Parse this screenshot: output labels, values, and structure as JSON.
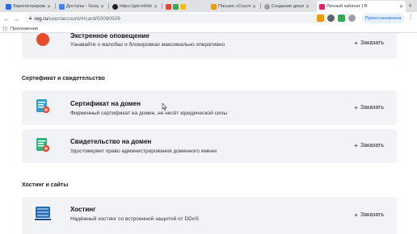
{
  "browser": {
    "tabs": [
      {
        "title": "Зарегистрировать Х",
        "favicon_color": "#1a73e8",
        "active": false
      },
      {
        "title": "Доступы - Google Д",
        "favicon_color": "#4285f4",
        "active": false
      },
      {
        "title": "https://get-infobiz",
        "favicon_color": "#202124",
        "active": false
      },
      {
        "title": "Письмо «Ссылка д",
        "favicon_color": "#f29900",
        "active": false
      },
      {
        "title": "Создание докумен",
        "favicon_color": "#9aa0a6",
        "active": false
      },
      {
        "title": "Личный кабинет | R",
        "favicon_color": "#e91e63",
        "active": true
      }
    ],
    "url_host": "reg.ru",
    "url_path": "/user/account/#/card/50090509",
    "profile_label": "Приостановлена",
    "bookmarks_label": "Приложения"
  },
  "cards": [
    {
      "title": "Экстренное оповещение",
      "desc": "Узнавайте о жалобах и блокировках максимально оперативно",
      "order": "Заказать",
      "icon": "alert-icon"
    },
    {
      "title": "Сертификат на домен",
      "desc": "Фирменный сертификат на домен, не несёт юридической силы",
      "order": "Заказать",
      "icon": "certificate-icon"
    },
    {
      "title": "Свидетельство на домен",
      "desc": "Удостоверяет право администрирования доменного имени",
      "order": "Заказать",
      "icon": "document-icon"
    },
    {
      "title": "Хостинг",
      "desc": "Надёжный хостинг со встроенной защитой от DDoS",
      "order": "Заказать",
      "icon": "server-icon"
    }
  ],
  "sections": {
    "certificates": "Сертификат и свидетельство",
    "hosting": "Хостинг и сайты"
  },
  "colors": {
    "card_bg": "#f2f3f7",
    "icon_green": "#2eb67d",
    "icon_blue": "#2b6cb0",
    "icon_red": "#e84a2c"
  }
}
